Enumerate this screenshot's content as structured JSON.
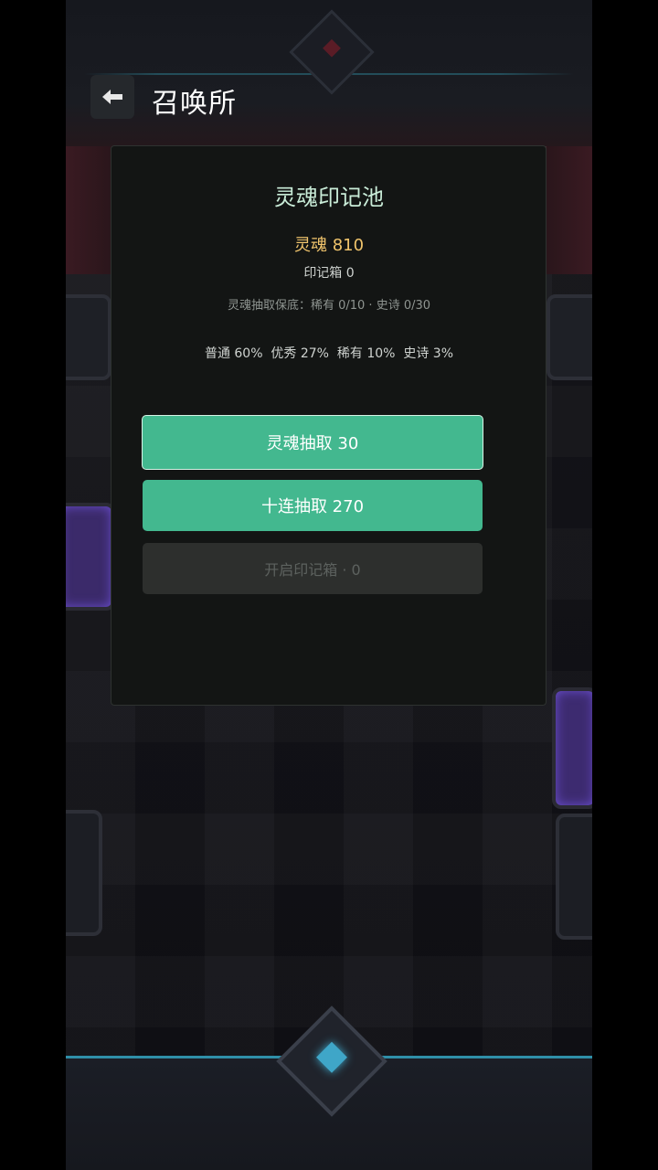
{
  "header": {
    "title": "召唤所",
    "back_icon": "back-arrow-icon"
  },
  "panel": {
    "title": "灵魂印记池",
    "soul_label": "灵魂",
    "soul_value": "810",
    "box_label": "印记箱",
    "box_value": "0",
    "pity_text": "灵魂抽取保底：稀有 0/10 · 史诗 0/30",
    "rates_text": "普通 60%  优秀 27%  稀有 10%  史诗 3%"
  },
  "buttons": {
    "single_draw": "灵魂抽取 30",
    "ten_draw": "十连抽取 270",
    "open_box": "开启印记箱 · 0"
  },
  "colors": {
    "accent": "#43b88f",
    "gold": "#f0c46c",
    "title_mint": "#c9ecd8",
    "disabled": "#2d2f2d"
  }
}
